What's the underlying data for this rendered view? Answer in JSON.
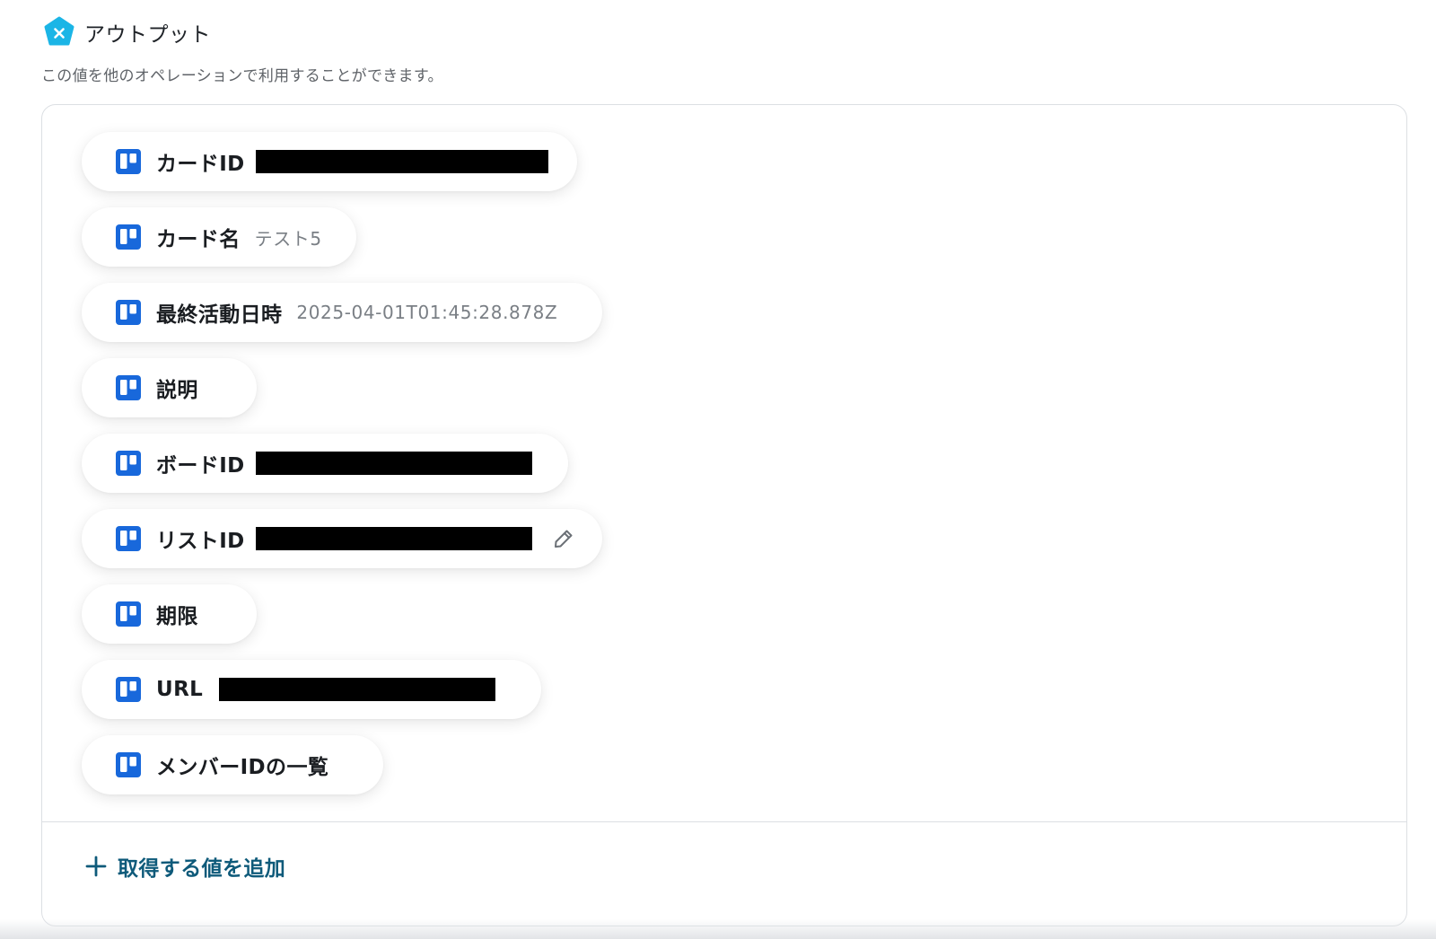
{
  "header": {
    "title": "アウトプット",
    "subtitle": "この値を他のオペレーションで利用することができます。",
    "badge_icon": "x-pentagon-icon",
    "badge_color": "#1bb5e6"
  },
  "outputs": [
    {
      "label": "カードID",
      "value": "",
      "redacted": true,
      "icon": "trello-icon"
    },
    {
      "label": "カード名",
      "value": "テスト5",
      "redacted": false,
      "icon": "trello-icon"
    },
    {
      "label": "最終活動日時",
      "value": "2025-04-01T01:45:28.878Z",
      "redacted": false,
      "icon": "trello-icon"
    },
    {
      "label": "説明",
      "value": "",
      "redacted": false,
      "icon": "trello-icon"
    },
    {
      "label": "ボードID",
      "value": "",
      "redacted": true,
      "icon": "trello-icon"
    },
    {
      "label": "リストID",
      "value": "",
      "redacted": true,
      "icon": "trello-icon",
      "edit_icon": "pencil-icon"
    },
    {
      "label": "期限",
      "value": "",
      "redacted": false,
      "icon": "trello-icon"
    },
    {
      "label": "URL",
      "value": "",
      "redacted": true,
      "icon": "trello-icon"
    },
    {
      "label": "メンバーIDの一覧",
      "value": "",
      "redacted": false,
      "icon": "trello-icon"
    }
  ],
  "add_button": {
    "label": "取得する値を追加",
    "icon": "plus-icon"
  },
  "colors": {
    "trello_blue": "#1868db",
    "accent_text": "#0e5a7a",
    "redaction": "#000000"
  }
}
